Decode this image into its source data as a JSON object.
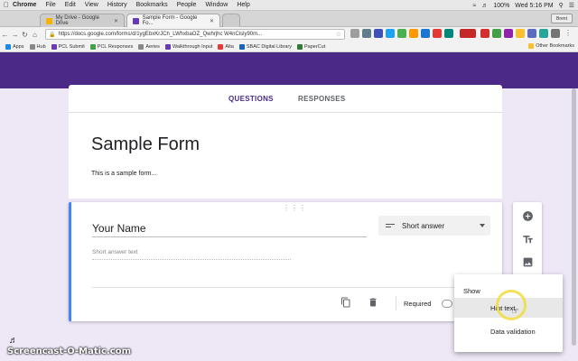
{
  "menubar": {
    "app": "Chrome",
    "items": [
      "File",
      "Edit",
      "View",
      "History",
      "Bookmarks",
      "People",
      "Window",
      "Help"
    ],
    "battery": "100%",
    "clock": "Wed 5:16 PM"
  },
  "browser": {
    "tabs": [
      {
        "title": "My Drive - Google Drive"
      },
      {
        "title": "Sample Form - Google Fo..."
      }
    ],
    "user_chip": "Brent",
    "url": "https://docs.google.com/forms/d/1ygEbxKrJCh_LWhxbaOZ_Qwhrjhc W4nCisly90m...",
    "bookmarks": [
      "Apps",
      "Hub",
      "PCL Submit",
      "PCL Responses",
      "Aeries",
      "Walkthrough Input",
      "Alta",
      "SBAC Digital Library",
      "PaperCut"
    ],
    "other_bookmarks": "Other Bookmarks"
  },
  "form_tabs": {
    "questions": "QUESTIONS",
    "responses": "RESPONSES"
  },
  "form": {
    "title": "Sample Form",
    "description": "This is a sample form..."
  },
  "question": {
    "title": "Your Name",
    "type": "Short answer",
    "placeholder": "Short answer text",
    "required_label": "Required"
  },
  "context_menu": {
    "header": "Show",
    "items": [
      "Hint text",
      "Data validation"
    ]
  },
  "watermark": "Screencast-O-Matic.com",
  "colors": {
    "brand": "#4a2a86",
    "background": "#ede7f6",
    "focus_border": "#4285f4"
  }
}
